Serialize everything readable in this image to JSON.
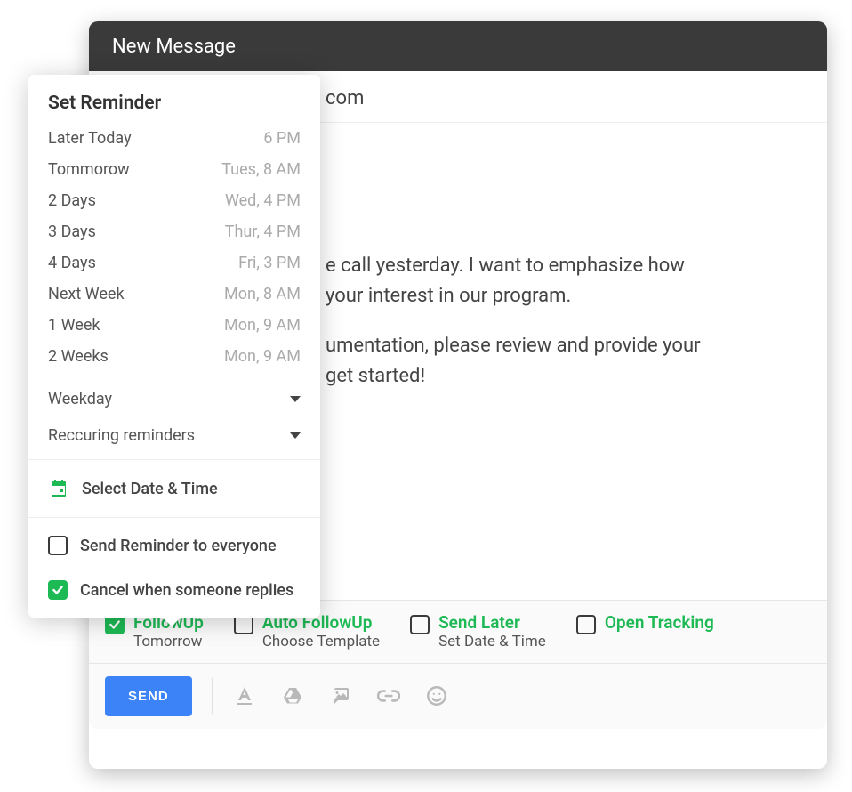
{
  "header": {
    "title": "New Message"
  },
  "to": {
    "visible_suffix": "com"
  },
  "body": {
    "p1_fragment": "e call yesterday. I want to emphasize how",
    "p2_fragment": "your interest in our program.",
    "p3_fragment": "umentation, please review and provide your",
    "p4_fragment": "get started!"
  },
  "popover": {
    "title": "Set Reminder",
    "items": [
      {
        "label": "Later Today",
        "time": "6 PM"
      },
      {
        "label": "Tommorow",
        "time": "Tues,  8 AM"
      },
      {
        "label": "2 Days",
        "time": "Wed, 4 PM"
      },
      {
        "label": "3 Days",
        "time": "Thur, 4 PM"
      },
      {
        "label": "4 Days",
        "time": "Fri, 3 PM"
      },
      {
        "label": "Next Week",
        "time": "Mon, 8 AM"
      },
      {
        "label": "1 Week",
        "time": "Mon, 9 AM"
      },
      {
        "label": "2 Weeks",
        "time": "Mon, 9 AM"
      }
    ],
    "dropdowns": {
      "weekday": "Weekday",
      "recurring": "Reccuring reminders"
    },
    "select_date": "Select Date & Time",
    "send_everyone": {
      "label": "Send Reminder to everyone",
      "checked": false
    },
    "cancel_on_reply": {
      "label": "Cancel when someone replies",
      "checked": true
    }
  },
  "options": {
    "followup": {
      "label": "FollowUp",
      "sub": "Tomorrow",
      "checked": true
    },
    "auto_followup": {
      "label": "Auto FollowUp",
      "sub": "Choose Template",
      "checked": false
    },
    "send_later": {
      "label": "Send Later",
      "sub": "Set Date & Time",
      "checked": false
    },
    "open_tracking": {
      "label": "Open Tracking",
      "sub": "",
      "checked": false
    }
  },
  "send": {
    "label": "SEND"
  },
  "colors": {
    "accent": "#1db954",
    "primary": "#3b83f6"
  }
}
